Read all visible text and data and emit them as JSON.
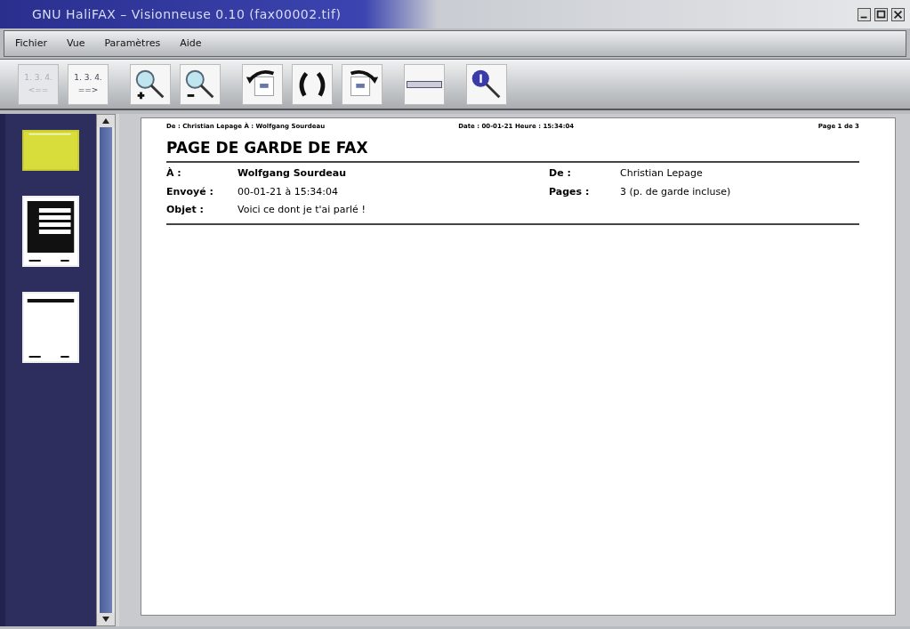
{
  "window": {
    "title": "GNU HaliFAX – Visionneuse 0.10 (fax00002.tif)"
  },
  "menu": [
    "Fichier",
    "Vue",
    "Paramètres",
    "Aide"
  ],
  "toolbar": [
    {
      "kind": "prev",
      "label": "1. 3. 4.",
      "arrow": "<==",
      "disabled": true
    },
    {
      "kind": "next",
      "label": "1. 3. 4.",
      "arrow": "==>",
      "disabled": false
    },
    {
      "kind": "zoom-in",
      "disabled": false
    },
    {
      "kind": "zoom-out",
      "disabled": false
    },
    {
      "kind": "rotate-left",
      "disabled": false
    },
    {
      "kind": "flip",
      "disabled": false
    },
    {
      "kind": "rotate-right",
      "disabled": false
    },
    {
      "kind": "fit-width",
      "disabled": false
    },
    {
      "kind": "info",
      "disabled": false
    }
  ],
  "thumbnails": [
    {
      "kind": "blank",
      "selected": true
    },
    {
      "kind": "table",
      "selected": false
    },
    {
      "kind": "list",
      "selected": false
    }
  ],
  "page": {
    "header_left": "De : Christian Lepage À : Wolfgang Sourdeau",
    "header_mid": "Date : 00-01-21 Heure : 15:34:04",
    "header_right": "Page 1 de 3",
    "title": "PAGE DE GARDE DE FAX",
    "fields": [
      {
        "label": "À :",
        "value": "Wolfgang Sourdeau",
        "bold": true
      },
      {
        "label": "De :",
        "value": "Christian Lepage",
        "bold": false
      },
      {
        "label": "Envoyé :",
        "value": "00-01-21 à 15:34:04",
        "bold": false
      },
      {
        "label": "Pages :",
        "value": "3 (p. de garde incluse)",
        "bold": false
      },
      {
        "label": "Objet :",
        "value": "Voici ce dont je t'ai parlé !",
        "bold": false
      }
    ]
  }
}
